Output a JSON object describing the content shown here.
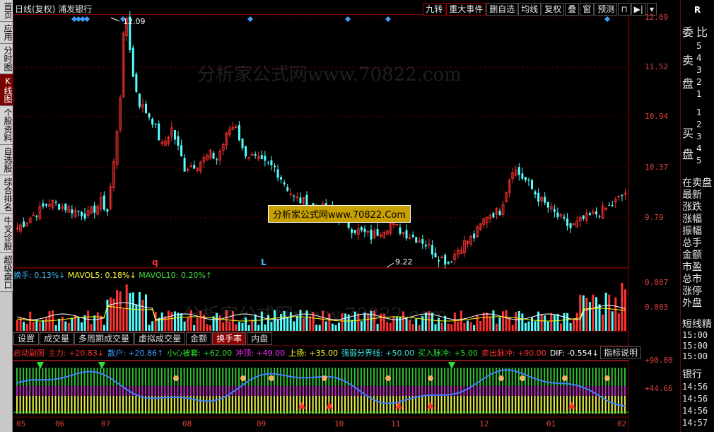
{
  "left_tabs": [
    {
      "label": "首页",
      "active": false
    },
    {
      "label": "应用",
      "active": false
    },
    {
      "label": "分时图",
      "active": false
    },
    {
      "label": "K线图",
      "active": true
    },
    {
      "label": "个股资料",
      "active": false
    },
    {
      "label": "自选股",
      "active": false
    },
    {
      "label": "综合排名",
      "active": false
    },
    {
      "label": "牛叉诊股",
      "active": false
    },
    {
      "label": "超级盘口",
      "active": false
    }
  ],
  "title": "日线(复权) 浦发银行",
  "toolbar": [
    "九转",
    "重大事件",
    "删自选",
    "均线",
    "复权",
    "叠",
    "窗",
    "预测"
  ],
  "price_ticks": [
    "12.09",
    "11.52",
    "10.94",
    "10.37",
    "9.79"
  ],
  "max_label": "12.09",
  "min_label": "9.22",
  "markers": {
    "q": "q",
    "L": "L"
  },
  "watermark": "分析家公式网www.70822.com",
  "watermark_box": "分析家公式网www.70822.Com",
  "volume": {
    "header_label": "换手:",
    "header_value": "0.13%↓",
    "ma5_label": "MAVOL5:",
    "ma5_value": "0.18%↓",
    "ma10_label": "MAVOL10:",
    "ma10_value": "0.20%↑",
    "ticks": [
      "0.007",
      "0.003"
    ]
  },
  "sub_tabs": [
    {
      "label": "设置",
      "active": false
    },
    {
      "label": "成交量",
      "active": false
    },
    {
      "label": "多周期成交量",
      "active": false
    },
    {
      "label": "虚拟成交量",
      "active": false
    },
    {
      "label": "金额",
      "active": false
    },
    {
      "label": "换手率",
      "active": true
    },
    {
      "label": "内盘",
      "active": false
    }
  ],
  "indicator": {
    "items": [
      {
        "text": "启动副图",
        "color": "#ff3030"
      },
      {
        "text": "主力: +20.83↓",
        "color": "#ff3030"
      },
      {
        "text": "散户: +20.86↑",
        "color": "#40a0ff"
      },
      {
        "text": "小心被套: +62.00",
        "color": "#30e030"
      },
      {
        "text": "冲顶: +49.00",
        "color": "#ff30ff"
      },
      {
        "text": "上扬: +35.00",
        "color": "#ffff30"
      },
      {
        "text": "强弱分界线: +50.00",
        "color": "#40e0e0"
      },
      {
        "text": "买入脉冲: +5.00",
        "color": "#30e030"
      },
      {
        "text": "卖出脉冲: +90.00",
        "color": "#ff3030"
      },
      {
        "text": "DIF: -0.554↓",
        "color": "#ffffff"
      },
      {
        "text": "DI",
        "color": "#ff3030"
      }
    ],
    "button": "指标说明",
    "ticks": [
      "+90.00",
      "+44.66"
    ]
  },
  "x_axis": [
    "05",
    "06",
    "07",
    "08",
    "09",
    "10",
    "11",
    "12",
    "01",
    "02"
  ],
  "right_panel": {
    "header": "R",
    "sell_labels": [
      "委",
      "比",
      "卖",
      "盘"
    ],
    "sell_nums": [
      "5",
      "4",
      "3",
      "2",
      "1"
    ],
    "buy_labels": [
      "买",
      "盘"
    ],
    "buy_nums": [
      "1",
      "2",
      "3",
      "4",
      "5"
    ],
    "items": [
      "在卖盘",
      "最新",
      "涨跌",
      "涨幅",
      "振幅",
      "总手",
      "金额",
      "市盈",
      "总市",
      "涨停",
      "外盘"
    ],
    "short": "短线精",
    "times1": [
      "15:00",
      "15:00",
      "15:00"
    ],
    "bank": "银行",
    "times2": [
      "14:56",
      "14:56",
      "14:56",
      "14:57"
    ]
  },
  "colors": {
    "up": "#ff3232",
    "down": "#54ffff",
    "grid": "#7a0000",
    "ma5": "#ffffff",
    "ma10": "#ffff00"
  }
}
